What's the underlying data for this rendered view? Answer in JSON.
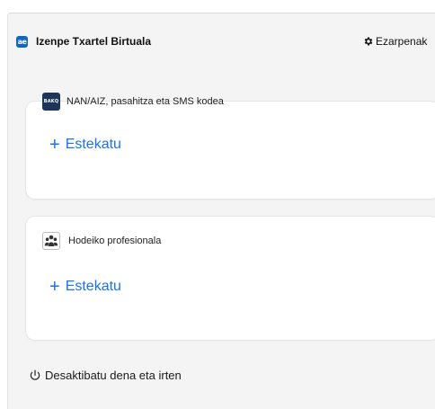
{
  "header": {
    "app_logo_text": "ae",
    "app_title": "Izenpe Txartel Birtuala",
    "settings_label": "Ezarpenak"
  },
  "cards": [
    {
      "icon": "bakq-icon",
      "icon_text": "BAKQ",
      "title": "NAN/AIZ, pasahitza eta SMS kodea",
      "link_label": "Estekatu"
    },
    {
      "icon": "people-group-icon",
      "title": "Hodeiko profesionala",
      "link_label": "Estekatu"
    }
  ],
  "footer": {
    "icon": "power-icon",
    "label": "Desaktibatu dena eta irten"
  },
  "colors": {
    "accent": "#1a73e8",
    "logo_bg": "#1565c0",
    "panel_bg": "#f4f4f4"
  }
}
